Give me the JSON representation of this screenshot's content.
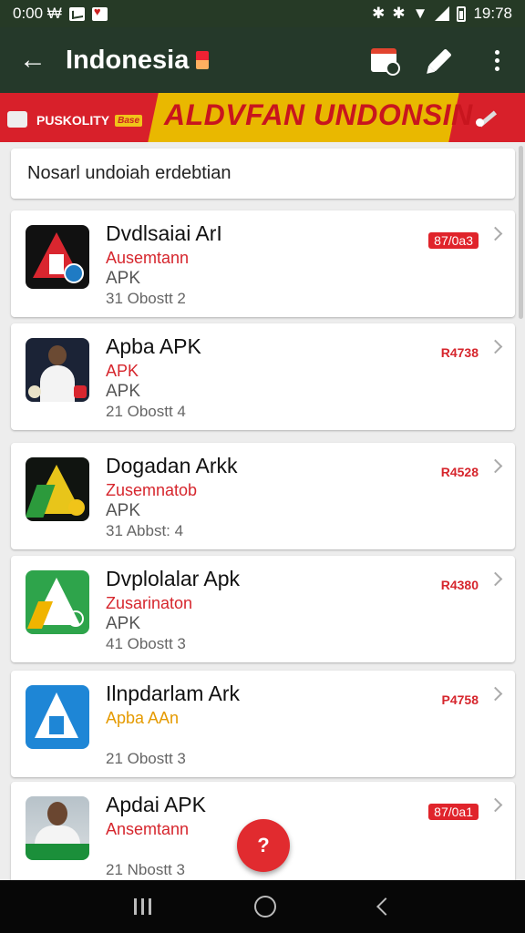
{
  "status_bar": {
    "time": "0:00 ₩",
    "clock": "19:78"
  },
  "app_bar": {
    "title": "Indonesia"
  },
  "banner": {
    "left_text": "PUSKOLITY",
    "badge": "Base",
    "title": "ALDVFAN UNDONSIN"
  },
  "search": {
    "placeholder": "Nosarl undoiah erdebtian"
  },
  "apps": [
    {
      "title": "Dvdlsaiai ArI",
      "subtitle": "Ausemtann",
      "type": "APK",
      "meta": "31 Obostt 2",
      "price": "87/0a3",
      "price_style": "pill",
      "icon": "red-a-app-icon"
    },
    {
      "title": "Apba APK",
      "subtitle": "APK",
      "type": "APK",
      "meta": "21 Obostt 4",
      "price": "R4738",
      "price_style": "text",
      "icon": "person-portrait-icon"
    },
    {
      "title": "Dogadan Arkk",
      "subtitle": "Zusemnatob",
      "type": "APK",
      "meta": "31 Abbst: 4",
      "price": "R4528",
      "price_style": "text",
      "icon": "yellow-a-app-icon"
    },
    {
      "title": "Dvplolalar Apk",
      "subtitle": "Zusarinaton",
      "type": "APK",
      "meta": "41 Obostt 3",
      "price": "R4380",
      "price_style": "text",
      "icon": "green-a-app-icon"
    },
    {
      "title": "Ilnpdarlam Ark",
      "subtitle": "Apba AAn",
      "subtitle_style": "orange",
      "type": "",
      "meta": "21 Obostt 3",
      "price": "P4758",
      "price_style": "text",
      "icon": "blue-a-app-icon"
    },
    {
      "title": "Apdai APK",
      "subtitle": "Ansemtann",
      "type": "",
      "meta": "21 Nbostt 3",
      "price": "87/0a1",
      "price_style": "pill",
      "icon": "man-photo-icon"
    }
  ],
  "fab": {
    "label": "?"
  },
  "colors": {
    "app_bar": "#25392a",
    "accent_red": "#d6262d",
    "banner_yellow": "#e9b800"
  }
}
